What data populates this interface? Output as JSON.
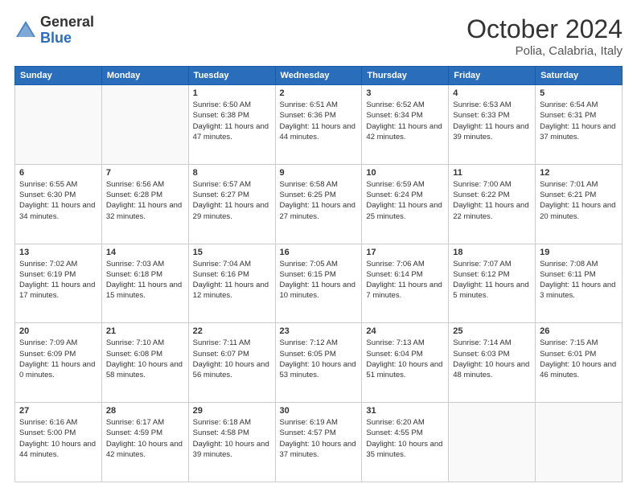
{
  "header": {
    "logo_general": "General",
    "logo_blue": "Blue",
    "month": "October 2024",
    "location": "Polia, Calabria, Italy"
  },
  "days_of_week": [
    "Sunday",
    "Monday",
    "Tuesday",
    "Wednesday",
    "Thursday",
    "Friday",
    "Saturday"
  ],
  "weeks": [
    [
      {
        "num": "",
        "info": ""
      },
      {
        "num": "",
        "info": ""
      },
      {
        "num": "1",
        "info": "Sunrise: 6:50 AM\nSunset: 6:38 PM\nDaylight: 11 hours and 47 minutes."
      },
      {
        "num": "2",
        "info": "Sunrise: 6:51 AM\nSunset: 6:36 PM\nDaylight: 11 hours and 44 minutes."
      },
      {
        "num": "3",
        "info": "Sunrise: 6:52 AM\nSunset: 6:34 PM\nDaylight: 11 hours and 42 minutes."
      },
      {
        "num": "4",
        "info": "Sunrise: 6:53 AM\nSunset: 6:33 PM\nDaylight: 11 hours and 39 minutes."
      },
      {
        "num": "5",
        "info": "Sunrise: 6:54 AM\nSunset: 6:31 PM\nDaylight: 11 hours and 37 minutes."
      }
    ],
    [
      {
        "num": "6",
        "info": "Sunrise: 6:55 AM\nSunset: 6:30 PM\nDaylight: 11 hours and 34 minutes."
      },
      {
        "num": "7",
        "info": "Sunrise: 6:56 AM\nSunset: 6:28 PM\nDaylight: 11 hours and 32 minutes."
      },
      {
        "num": "8",
        "info": "Sunrise: 6:57 AM\nSunset: 6:27 PM\nDaylight: 11 hours and 29 minutes."
      },
      {
        "num": "9",
        "info": "Sunrise: 6:58 AM\nSunset: 6:25 PM\nDaylight: 11 hours and 27 minutes."
      },
      {
        "num": "10",
        "info": "Sunrise: 6:59 AM\nSunset: 6:24 PM\nDaylight: 11 hours and 25 minutes."
      },
      {
        "num": "11",
        "info": "Sunrise: 7:00 AM\nSunset: 6:22 PM\nDaylight: 11 hours and 22 minutes."
      },
      {
        "num": "12",
        "info": "Sunrise: 7:01 AM\nSunset: 6:21 PM\nDaylight: 11 hours and 20 minutes."
      }
    ],
    [
      {
        "num": "13",
        "info": "Sunrise: 7:02 AM\nSunset: 6:19 PM\nDaylight: 11 hours and 17 minutes."
      },
      {
        "num": "14",
        "info": "Sunrise: 7:03 AM\nSunset: 6:18 PM\nDaylight: 11 hours and 15 minutes."
      },
      {
        "num": "15",
        "info": "Sunrise: 7:04 AM\nSunset: 6:16 PM\nDaylight: 11 hours and 12 minutes."
      },
      {
        "num": "16",
        "info": "Sunrise: 7:05 AM\nSunset: 6:15 PM\nDaylight: 11 hours and 10 minutes."
      },
      {
        "num": "17",
        "info": "Sunrise: 7:06 AM\nSunset: 6:14 PM\nDaylight: 11 hours and 7 minutes."
      },
      {
        "num": "18",
        "info": "Sunrise: 7:07 AM\nSunset: 6:12 PM\nDaylight: 11 hours and 5 minutes."
      },
      {
        "num": "19",
        "info": "Sunrise: 7:08 AM\nSunset: 6:11 PM\nDaylight: 11 hours and 3 minutes."
      }
    ],
    [
      {
        "num": "20",
        "info": "Sunrise: 7:09 AM\nSunset: 6:09 PM\nDaylight: 11 hours and 0 minutes."
      },
      {
        "num": "21",
        "info": "Sunrise: 7:10 AM\nSunset: 6:08 PM\nDaylight: 10 hours and 58 minutes."
      },
      {
        "num": "22",
        "info": "Sunrise: 7:11 AM\nSunset: 6:07 PM\nDaylight: 10 hours and 56 minutes."
      },
      {
        "num": "23",
        "info": "Sunrise: 7:12 AM\nSunset: 6:05 PM\nDaylight: 10 hours and 53 minutes."
      },
      {
        "num": "24",
        "info": "Sunrise: 7:13 AM\nSunset: 6:04 PM\nDaylight: 10 hours and 51 minutes."
      },
      {
        "num": "25",
        "info": "Sunrise: 7:14 AM\nSunset: 6:03 PM\nDaylight: 10 hours and 48 minutes."
      },
      {
        "num": "26",
        "info": "Sunrise: 7:15 AM\nSunset: 6:01 PM\nDaylight: 10 hours and 46 minutes."
      }
    ],
    [
      {
        "num": "27",
        "info": "Sunrise: 6:16 AM\nSunset: 5:00 PM\nDaylight: 10 hours and 44 minutes."
      },
      {
        "num": "28",
        "info": "Sunrise: 6:17 AM\nSunset: 4:59 PM\nDaylight: 10 hours and 42 minutes."
      },
      {
        "num": "29",
        "info": "Sunrise: 6:18 AM\nSunset: 4:58 PM\nDaylight: 10 hours and 39 minutes."
      },
      {
        "num": "30",
        "info": "Sunrise: 6:19 AM\nSunset: 4:57 PM\nDaylight: 10 hours and 37 minutes."
      },
      {
        "num": "31",
        "info": "Sunrise: 6:20 AM\nSunset: 4:55 PM\nDaylight: 10 hours and 35 minutes."
      },
      {
        "num": "",
        "info": ""
      },
      {
        "num": "",
        "info": ""
      }
    ]
  ]
}
